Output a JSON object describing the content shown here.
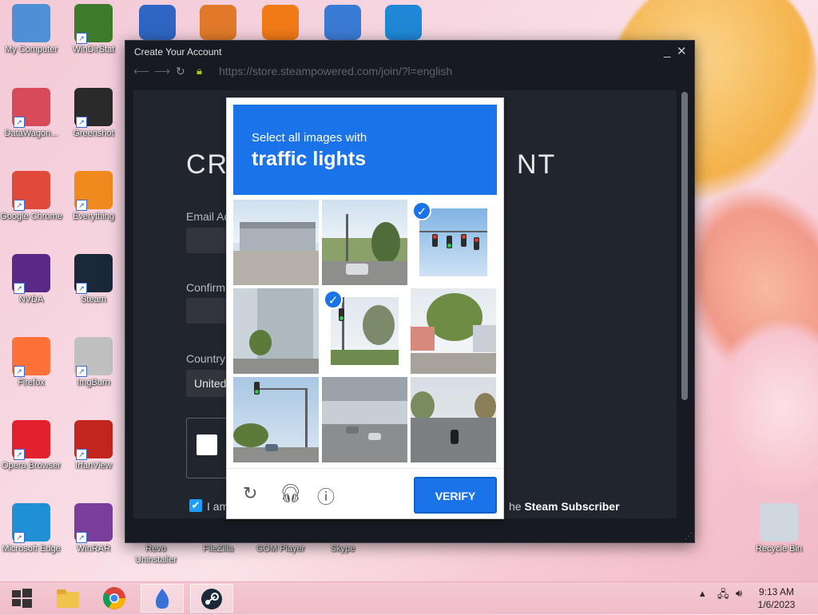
{
  "desktop": {
    "icons": [
      {
        "label": "My Computer",
        "icon": "computer-icon",
        "color": "#4f8fd6"
      },
      {
        "label": "WinDirStat",
        "icon": "tree-icon",
        "color": "#3d7a2c"
      },
      {
        "label": "DataWagon...",
        "icon": "datawagon-icon",
        "color": "#d84a5a"
      },
      {
        "label": "Greenshot",
        "icon": "greenshot-icon",
        "color": "#2a2a2a"
      },
      {
        "label": "Google Chrome",
        "icon": "chrome-icon",
        "color": "#e04a3a"
      },
      {
        "label": "Everything",
        "icon": "magnifier-icon",
        "color": "#f08a1e"
      },
      {
        "label": "NVDA",
        "icon": "nvda-icon",
        "color": "#5a2a86"
      },
      {
        "label": "Steam",
        "icon": "steam-icon",
        "color": "#1b2838"
      },
      {
        "label": "Firefox",
        "icon": "firefox-icon",
        "color": "#ff7139"
      },
      {
        "label": "ImgBurn",
        "icon": "disc-icon",
        "color": "#c0c0c0"
      },
      {
        "label": "Opera Browser",
        "icon": "opera-icon",
        "color": "#e3212e"
      },
      {
        "label": "IrfanView",
        "icon": "irfanview-icon",
        "color": "#c2261e"
      },
      {
        "label": "Microsoft Edge",
        "icon": "edge-icon",
        "color": "#1f8fd6"
      },
      {
        "label": "WinRAR",
        "icon": "winrar-icon",
        "color": "#7a3f9a"
      },
      {
        "label": "Revo Uninstaller",
        "icon": "revo-icon",
        "color": "#d43b3b"
      },
      {
        "label": "FileZilla",
        "icon": "filezilla-icon",
        "color": "#bf0000"
      },
      {
        "label": "GOM Player",
        "icon": "gom-icon",
        "color": "#e0a020"
      },
      {
        "label": "Skype",
        "icon": "skype-icon",
        "color": "#00aff0"
      },
      {
        "label": "Recycle Bin",
        "icon": "recycle-bin-icon",
        "color": "#cfd8e0"
      }
    ],
    "top_icons": [
      {
        "icon": "network-icon",
        "color": "#2f66c4"
      },
      {
        "icon": "eye-icon",
        "color": "#e07a2a"
      },
      {
        "icon": "audacity-icon",
        "color": "#f07a16"
      },
      {
        "icon": "qbittorrent-icon",
        "color": "#3a7bd5"
      },
      {
        "icon": "vscode-icon",
        "color": "#1e88d6"
      }
    ]
  },
  "window": {
    "title": "Create Your Account",
    "url": "https://store.steampowered.com/join/?l=english",
    "heading_left": "CRE",
    "heading_right": "NT",
    "email_label": "Email Ad",
    "confirm_label": "Confirm",
    "country_label": "Country",
    "country_value": "United",
    "agree_left": "I am",
    "agree_right_prefix": "he ",
    "agree_right_bold": "Steam Subscriber"
  },
  "captcha": {
    "prompt_line1": "Select all images with",
    "prompt_line2": "traffic lights",
    "verify_label": "VERIFY",
    "selected_tiles": [
      2,
      4
    ]
  },
  "taskbar": {
    "time": "9:13 AM",
    "date": "1/6/2023"
  }
}
